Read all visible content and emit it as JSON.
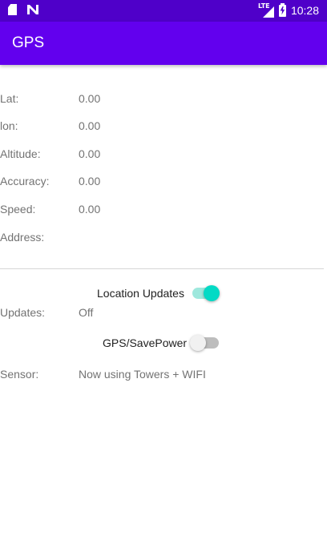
{
  "status_bar": {
    "icons": [
      "sd-card-icon",
      "n-notification-icon",
      "lte-signal-icon",
      "battery-charging-icon"
    ],
    "lte": "LTE",
    "time": "10:28"
  },
  "app_bar": {
    "title": "GPS"
  },
  "fields": {
    "lat": {
      "label": "Lat:",
      "value": "0.00"
    },
    "lon": {
      "label": "lon:",
      "value": "0.00"
    },
    "altitude": {
      "label": "Altitude:",
      "value": "0.00"
    },
    "accuracy": {
      "label": "Accuracy:",
      "value": "0.00"
    },
    "speed": {
      "label": "Speed:",
      "value": "0.00"
    },
    "address": {
      "label": "Address:",
      "value": ""
    }
  },
  "location_updates_switch": {
    "label": "Location Updates",
    "checked": true
  },
  "updates": {
    "label": "Updates:",
    "value": "Off"
  },
  "gps_savepower_switch": {
    "label": "GPS/SavePower",
    "checked": false
  },
  "sensor": {
    "label": "Sensor:",
    "value": "Now using Towers + WIFI"
  },
  "colors": {
    "status_bar": "#4f00c9",
    "app_bar": "#6200ee",
    "switch_on": "#03dac5",
    "label_text": "#737373"
  }
}
